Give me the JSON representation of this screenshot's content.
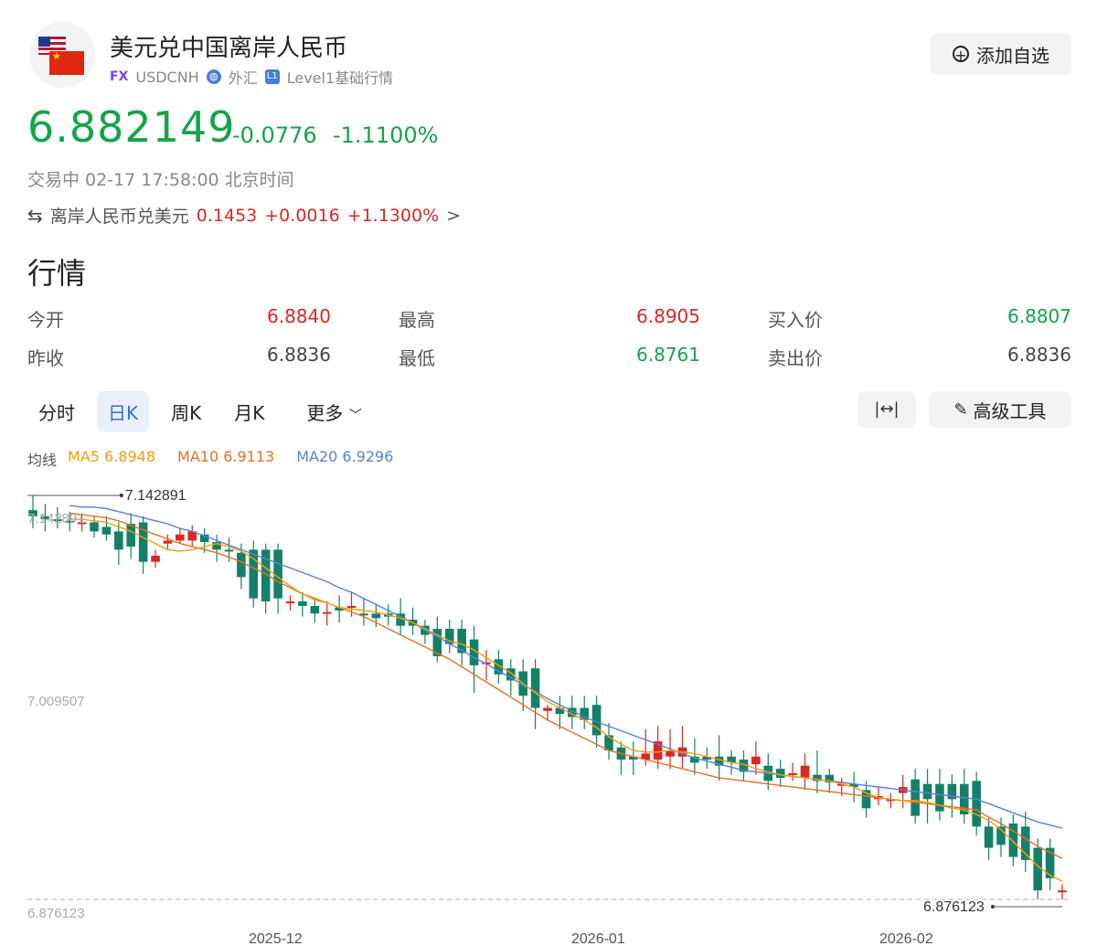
{
  "header": {
    "title": "美元兑中国离岸人民币",
    "fx_badge": "FX",
    "symbol": "USDCNH",
    "category": "外汇",
    "level_badge": "L1",
    "level_text": "Level1基础行情",
    "add_button": "添加自选"
  },
  "quote": {
    "price": "6.882149",
    "change": "-0.0776",
    "change_pct": "-1.1100%",
    "status": "交易中 02-17 17:58:00 北京时间",
    "inverse_label": "离岸人民币兑美元",
    "inverse_price": "0.1453",
    "inverse_change": "+0.0016",
    "inverse_pct": "+1.1300%",
    "inverse_arrow": ">"
  },
  "market": {
    "section_title": "行情",
    "open_label": "今开",
    "open": "6.8840",
    "high_label": "最高",
    "high": "6.8905",
    "bid_label": "买入价",
    "bid": "6.8807",
    "prev_label": "昨收",
    "prev": "6.8836",
    "low_label": "最低",
    "low": "6.8761",
    "ask_label": "卖出价",
    "ask": "6.8836"
  },
  "tabs": [
    "分时",
    "日K",
    "周K",
    "月K",
    "更多"
  ],
  "tools": {
    "fit_icon": "|↔|",
    "advanced": "高级工具"
  },
  "ma": {
    "label": "均线",
    "ma5": "MA5 6.8948",
    "ma10": "MA10 6.9113",
    "ma20": "MA20 6.9296"
  },
  "colors": {
    "up": "#dc2626",
    "down": "#15806a",
    "ma5": "#f59e0b",
    "ma10": "#ea6f20",
    "ma20": "#5b7fdc"
  },
  "chart_data": {
    "type": "candlestick",
    "y_labels": [
      "7.142891",
      "7.009507",
      "6.876123"
    ],
    "high_marker": "7.142891",
    "low_marker": "6.876123",
    "x_labels": [
      "2025-12",
      "2026-01",
      "2026-02"
    ],
    "ylim": [
      6.876123,
      7.142891
    ],
    "candles": [
      [
        7.132,
        7.128,
        7.142,
        7.12
      ],
      [
        7.128,
        7.126,
        7.136,
        7.118
      ],
      [
        7.126,
        7.125,
        7.134,
        7.12
      ],
      [
        7.125,
        7.124,
        7.131,
        7.118
      ],
      [
        7.124,
        7.124,
        7.13,
        7.118
      ],
      [
        7.124,
        7.118,
        7.128,
        7.114
      ],
      [
        7.121,
        7.116,
        7.128,
        7.112
      ],
      [
        7.118,
        7.106,
        7.124,
        7.096
      ],
      [
        7.123,
        7.108,
        7.13,
        7.1
      ],
      [
        7.124,
        7.098,
        7.128,
        7.09
      ],
      [
        7.098,
        7.102,
        7.106,
        7.094
      ],
      [
        7.11,
        7.112,
        7.116,
        7.106
      ],
      [
        7.112,
        7.116,
        7.12,
        7.11
      ],
      [
        7.112,
        7.118,
        7.122,
        7.108
      ],
      [
        7.116,
        7.111,
        7.12,
        7.104
      ],
      [
        7.111,
        7.106,
        7.116,
        7.098
      ],
      [
        7.106,
        7.105,
        7.114,
        7.098
      ],
      [
        7.104,
        7.088,
        7.11,
        7.08
      ],
      [
        7.106,
        7.074,
        7.112,
        7.068
      ],
      [
        7.106,
        7.072,
        7.11,
        7.064
      ],
      [
        7.106,
        7.074,
        7.11,
        7.064
      ],
      [
        7.072,
        7.072,
        7.076,
        7.066
      ],
      [
        7.072,
        7.069,
        7.078,
        7.062
      ],
      [
        7.069,
        7.064,
        7.074,
        7.058
      ],
      [
        7.064,
        7.065,
        7.072,
        7.056
      ],
      [
        7.068,
        7.066,
        7.076,
        7.058
      ],
      [
        7.068,
        7.069,
        7.078,
        7.062
      ],
      [
        7.064,
        7.063,
        7.074,
        7.056
      ],
      [
        7.064,
        7.061,
        7.07,
        7.055
      ],
      [
        7.064,
        7.062,
        7.07,
        7.056
      ],
      [
        7.064,
        7.056,
        7.074,
        7.05
      ],
      [
        7.06,
        7.056,
        7.068,
        7.05
      ],
      [
        7.056,
        7.05,
        7.06,
        7.044
      ],
      [
        7.054,
        7.036,
        7.062,
        7.032
      ],
      [
        7.054,
        7.044,
        7.06,
        7.038
      ],
      [
        7.054,
        7.038,
        7.06,
        7.03
      ],
      [
        7.047,
        7.03,
        7.056,
        7.012
      ],
      [
        7.032,
        7.032,
        7.04,
        7.02
      ],
      [
        7.034,
        7.024,
        7.04,
        7.018
      ],
      [
        7.028,
        7.02,
        7.034,
        7.01
      ],
      [
        7.026,
        7.01,
        7.034,
        7.0
      ],
      [
        7.028,
        7.002,
        7.034,
        6.988
      ],
      [
        7.0,
        7.002,
        7.004,
        6.994
      ],
      [
        7.002,
        6.998,
        7.01,
        6.988
      ],
      [
        7.002,
        6.996,
        7.01,
        6.988
      ],
      [
        7.002,
        6.994,
        7.01,
        6.988
      ],
      [
        7.004,
        6.984,
        7.01,
        6.976
      ],
      [
        6.984,
        6.974,
        6.992,
        6.968
      ],
      [
        6.976,
        6.968,
        6.98,
        6.958
      ],
      [
        6.97,
        6.968,
        6.98,
        6.958
      ],
      [
        6.968,
        6.972,
        6.988,
        6.964
      ],
      [
        6.968,
        6.98,
        6.99,
        6.962
      ],
      [
        6.97,
        6.974,
        6.988,
        6.962
      ],
      [
        6.97,
        6.976,
        6.99,
        6.962
      ],
      [
        6.97,
        6.966,
        6.982,
        6.958
      ],
      [
        6.97,
        6.968,
        6.976,
        6.962
      ],
      [
        6.97,
        6.964,
        6.984,
        6.954
      ],
      [
        6.97,
        6.966,
        6.974,
        6.958
      ],
      [
        6.968,
        6.96,
        6.974,
        6.954
      ],
      [
        6.965,
        6.97,
        6.98,
        6.958
      ],
      [
        6.964,
        6.954,
        6.972,
        6.948
      ],
      [
        6.962,
        6.956,
        6.968,
        6.95
      ],
      [
        6.959,
        6.959,
        6.966,
        6.954
      ],
      [
        6.956,
        6.964,
        6.972,
        6.948
      ],
      [
        6.958,
        6.954,
        6.974,
        6.946
      ],
      [
        6.958,
        6.953,
        6.962,
        6.946
      ],
      [
        6.951,
        6.952,
        6.956,
        6.944
      ],
      [
        6.952,
        6.95,
        6.96,
        6.94
      ],
      [
        6.948,
        6.936,
        6.954,
        6.93
      ],
      [
        6.942,
        6.944,
        6.95,
        6.938
      ],
      [
        6.942,
        6.942,
        6.946,
        6.936
      ],
      [
        6.946,
        6.95,
        6.958,
        6.936
      ],
      [
        6.955,
        6.931,
        6.962,
        6.926
      ],
      [
        6.952,
        6.942,
        6.962,
        6.926
      ],
      [
        6.952,
        6.934,
        6.962,
        6.928
      ],
      [
        6.952,
        6.942,
        6.958,
        6.93
      ],
      [
        6.952,
        6.932,
        6.962,
        6.926
      ],
      [
        6.954,
        6.924,
        6.96,
        6.918
      ],
      [
        6.924,
        6.91,
        6.93,
        6.902
      ],
      [
        6.924,
        6.912,
        6.93,
        6.904
      ],
      [
        6.926,
        6.904,
        6.932,
        6.898
      ],
      [
        6.924,
        6.902,
        6.934,
        6.894
      ],
      [
        6.91,
        6.882,
        6.916,
        6.876
      ],
      [
        6.91,
        6.89,
        6.916,
        6.882
      ],
      [
        6.882,
        6.882,
        6.886,
        6.876
      ]
    ],
    "ma5": [
      7.126,
      7.126,
      7.125,
      7.124,
      7.121,
      7.118,
      7.114,
      7.11,
      7.106,
      7.105,
      7.106,
      7.108,
      7.11,
      7.108,
      7.105,
      7.1,
      7.094,
      7.088,
      7.082,
      7.077,
      7.073,
      7.071,
      7.068,
      7.067,
      7.066,
      7.065,
      7.063,
      7.061,
      7.058,
      7.054,
      7.05,
      7.046,
      7.044,
      7.04,
      7.035,
      7.03,
      7.025,
      7.018,
      7.012,
      7.006,
      7.002,
      6.998,
      6.994,
      6.989,
      6.983,
      6.978,
      6.974,
      6.973,
      6.973,
      6.974,
      6.973,
      6.972,
      6.97,
      6.968,
      6.966,
      6.965,
      6.962,
      6.96,
      6.958,
      6.957,
      6.956,
      6.955,
      6.954,
      6.952,
      6.95,
      6.946,
      6.943,
      6.942,
      6.941,
      6.941,
      6.94,
      6.938,
      6.936,
      6.935,
      6.932,
      6.928,
      6.922,
      6.914,
      6.906,
      6.898,
      6.892,
      6.888
    ],
    "ma10": [
      7.13,
      7.129,
      7.128,
      7.127,
      7.125,
      7.122,
      7.119,
      7.116,
      7.113,
      7.11,
      7.108,
      7.106,
      7.104,
      7.101,
      7.098,
      7.094,
      7.09,
      7.085,
      7.081,
      7.077,
      7.074,
      7.071,
      7.068,
      7.065,
      7.062,
      7.058,
      7.054,
      7.05,
      7.046,
      7.042,
      7.038,
      7.034,
      7.029,
      7.024,
      7.019,
      7.014,
      7.009,
      7.004,
      6.999,
      6.994,
      6.99,
      6.986,
      6.982,
      6.978,
      6.974,
      6.972,
      6.97,
      6.968,
      6.966,
      6.964,
      6.962,
      6.96,
      6.958,
      6.956,
      6.955,
      6.954,
      6.953,
      6.952,
      6.951,
      6.95,
      6.949,
      6.948,
      6.947,
      6.946,
      6.945,
      6.944,
      6.943,
      6.942,
      6.941,
      6.94,
      6.939,
      6.938,
      6.937,
      6.936,
      6.935,
      6.93,
      6.926,
      6.921,
      6.916,
      6.911,
      6.907,
      6.903
    ],
    "ma20": [
      7.135,
      7.134,
      7.134,
      7.133,
      7.131,
      7.129,
      7.127,
      7.125,
      7.123,
      7.12,
      7.118,
      7.115,
      7.112,
      7.109,
      7.106,
      7.103,
      7.1,
      7.097,
      7.094,
      7.091,
      7.088,
      7.085,
      7.081,
      7.078,
      7.074,
      7.07,
      7.066,
      7.062,
      7.058,
      7.053,
      7.049,
      7.044,
      7.04,
      7.035,
      7.031,
      7.026,
      7.022,
      7.017,
      7.013,
      7.008,
      7.004,
      7.0,
      6.996,
      6.993,
      6.99,
      6.987,
      6.984,
      6.981,
      6.978,
      6.975,
      6.972,
      6.969,
      6.967,
      6.965,
      6.963,
      6.961,
      6.96,
      6.959,
      6.958,
      6.957,
      6.956,
      6.955,
      6.954,
      6.953,
      6.952,
      6.951,
      6.95,
      6.949,
      6.948,
      6.947,
      6.946,
      6.945,
      6.944,
      6.943,
      6.942,
      6.939,
      6.936,
      6.933,
      6.93,
      6.927,
      6.925,
      6.923
    ]
  }
}
